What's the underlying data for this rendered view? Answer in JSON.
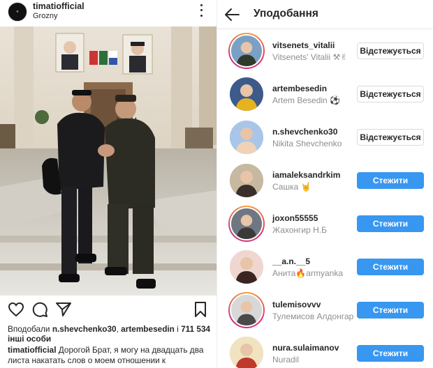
{
  "post": {
    "username": "timatiofficial",
    "location": "Grozny",
    "likes_prefix": "Вподобали ",
    "liked_by_1": "n.shevchenko30",
    "liked_sep": ", ",
    "liked_by_2": "artembesedin",
    "likes_mid": " і ",
    "likes_count": "711 534",
    "likes_suffix": "інші особи",
    "caption_user": "timatiofficial",
    "caption_text": " Дорогой Брат, я могу на двадцать два листа накатать слов о моем отношении к"
  },
  "likes_panel": {
    "title": "Уподобання",
    "users": [
      {
        "username": "vitsenets_vitalii",
        "full_name": "Vitsenets' Vitalii ⚒✌",
        "button": "Відстежується",
        "state": "following",
        "ring": true
      },
      {
        "username": "artembesedin",
        "full_name": "Artem Besedin ⚽",
        "button": "Відстежується",
        "state": "following",
        "ring": false
      },
      {
        "username": "n.shevchenko30",
        "full_name": "Nikita Shevchenko",
        "button": "Відстежується",
        "state": "following",
        "ring": false
      },
      {
        "username": "iamaleksandrkim",
        "full_name": "Сашка 🤘",
        "button": "Стежити",
        "state": "follow",
        "ring": false
      },
      {
        "username": "joxon55555",
        "full_name": "Жахонгир Н.Б",
        "button": "Стежити",
        "state": "follow",
        "ring": true
      },
      {
        "username": "__a.n.__5",
        "full_name": "Анита🔥armyanka",
        "button": "Стежити",
        "state": "follow",
        "ring": false
      },
      {
        "username": "tulemisovvv",
        "full_name": "Тулемисов Алдонгар",
        "button": "Стежити",
        "state": "follow",
        "ring": true
      },
      {
        "username": "nura.sulaimanov",
        "full_name": "Nuradil",
        "button": "Стежити",
        "state": "follow",
        "ring": false
      }
    ]
  },
  "colors": {
    "follow_blue": "#3897f0",
    "secondary_text": "#8e8e8e",
    "primary_text": "#262626"
  },
  "icons": [
    "heart-icon",
    "comment-icon",
    "share-icon",
    "bookmark-icon",
    "back-arrow-icon",
    "more-options-icon"
  ]
}
